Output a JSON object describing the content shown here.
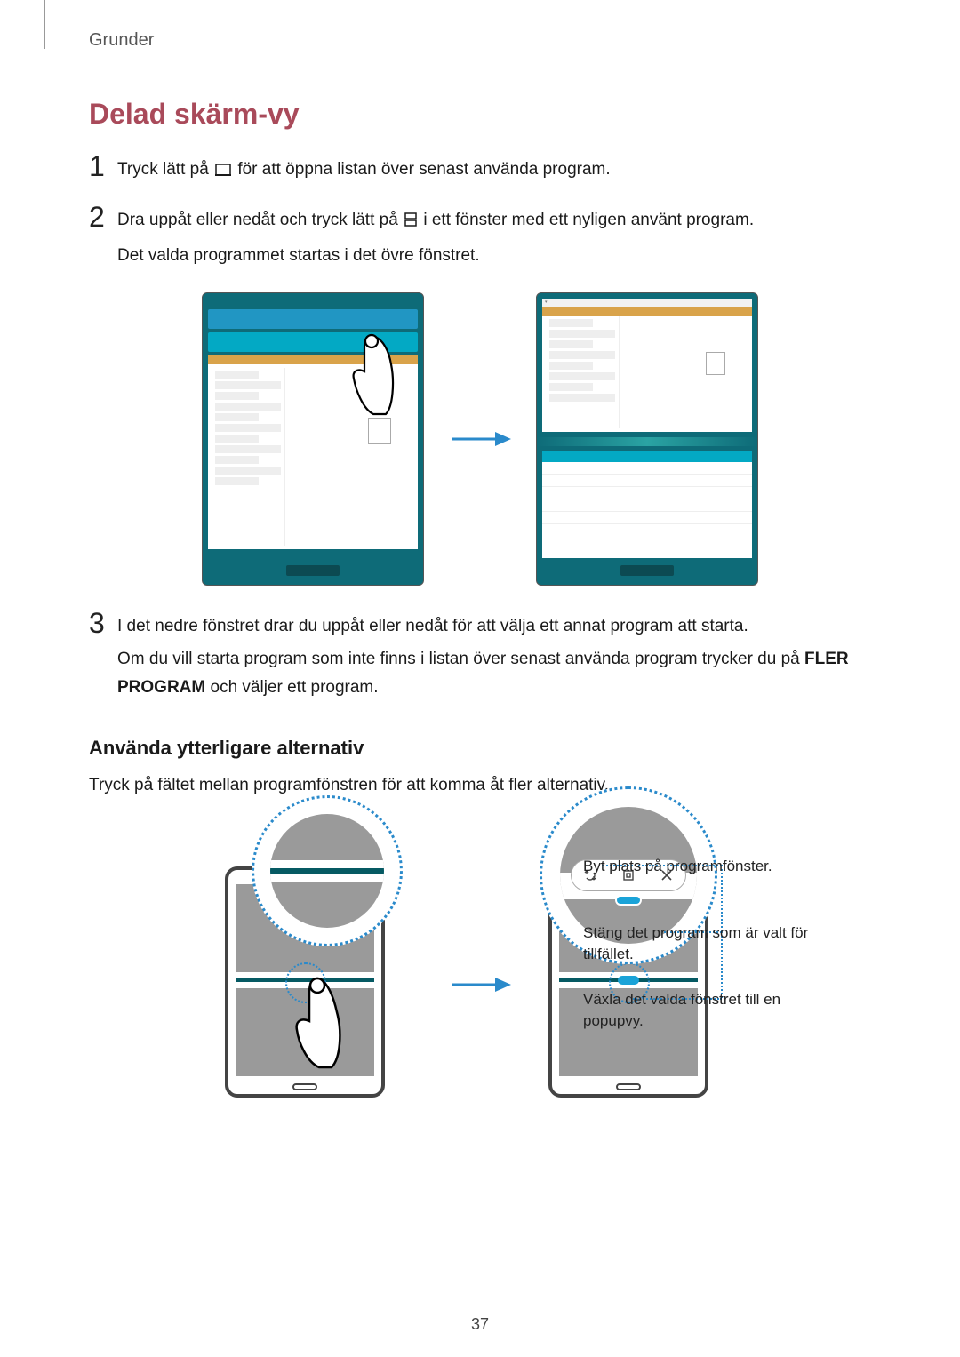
{
  "header": {
    "breadcrumb": "Grunder"
  },
  "section": {
    "title": "Delad skärm-vy"
  },
  "steps": [
    {
      "num": "1",
      "text_before": "Tryck lätt på ",
      "text_after": " för att öppna listan över senast använda program."
    },
    {
      "num": "2",
      "line1_before": "Dra uppåt eller nedåt och tryck lätt på ",
      "line1_after": " i ett fönster med ett nyligen använt program.",
      "line2": "Det valda programmet startas i det övre fönstret."
    },
    {
      "num": "3",
      "line1": "I det nedre fönstret drar du uppåt eller nedåt för att välja ett annat program att starta.",
      "line2_before": "Om du vill starta program som inte finns i listan över senast använda program trycker du på ",
      "line2_bold": "FLER PROGRAM",
      "line2_after": " och väljer ett program."
    }
  ],
  "subheading": "Använda ytterligare alternativ",
  "subtext": "Tryck på fältet mellan programfönstren för att komma åt fler alternativ.",
  "annotations": {
    "swap": "Byt plats på programfönster.",
    "close": "Stäng det program som är valt för tillfället.",
    "popup": "Växla det valda fönstret till en popupvy."
  },
  "page_number": "37"
}
